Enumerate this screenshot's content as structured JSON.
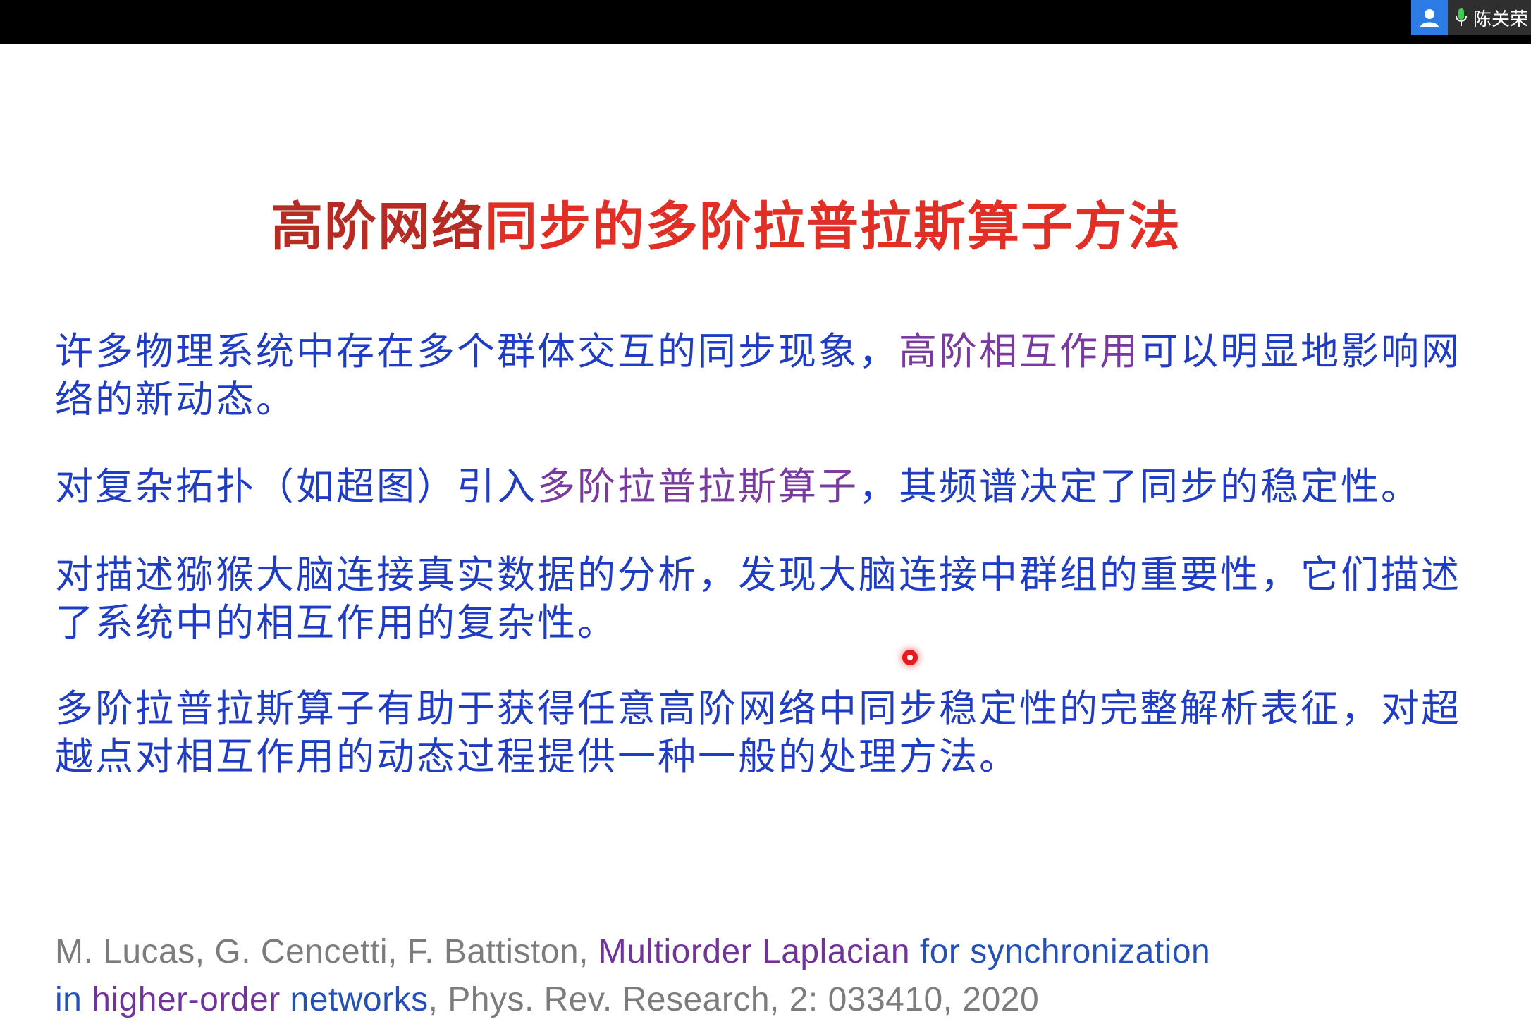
{
  "meeting": {
    "speaker_name": "陈关荣",
    "avatar_icon": "person-icon",
    "mic_icon": "microphone-icon"
  },
  "slide": {
    "title": {
      "part1": "高阶网络",
      "part2": "同步的多阶拉普拉斯算子方法"
    },
    "paragraphs": [
      {
        "a": "许多物理系统中存在多个群体交互的同步现象，",
        "b": "高阶相互作用",
        "c": "可以明显地影响网络的新动态。"
      },
      {
        "a": "对复杂拓扑（如超图）引入",
        "b": "多阶拉普拉斯算子",
        "c": "，其频谱决定了同步的稳定性。"
      },
      {
        "a": "对描述猕猴大脑连接真实数据的分析，发现大脑连接中群组的重要性，它们描述了系统中的相互作用的复杂性。"
      },
      {
        "a": "多阶拉普拉斯算子有助于获得任意高阶网络中同步稳定性的完整解析表征，对超越点对相互作用的动态过程提供一种一般的处理方法。"
      }
    ],
    "reference": {
      "authors": "M. Lucas, G. Cencetti, F. Battiston, ",
      "title_1": "Multiorder Laplacian",
      "title_2": " for synchronization",
      "title_3": "in ",
      "title_4": "higher-order",
      "title_5": " networks",
      "journal": ", Phys. Rev. Research, 2: 033410, 2020"
    }
  },
  "colors": {
    "title_dark": "#b62b23",
    "title_bright": "#e12f26",
    "body_blue": "#1f3cc4",
    "highlight_purple": "#7a3aa0",
    "reference_gray": "#7c7c7c",
    "pointer_red": "#e21b1b"
  }
}
